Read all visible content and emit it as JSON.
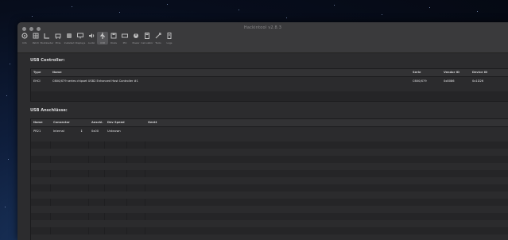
{
  "window": {
    "title": "Hackintool v2.8.3"
  },
  "toolbar": {
    "items": [
      {
        "label": "Info",
        "icon": "gear-icon"
      },
      {
        "label": "Patch",
        "icon": "puzzle-icon"
      },
      {
        "label": "Bootloader",
        "icon": "boot-icon"
      },
      {
        "label": "PCIe",
        "icon": "pcie-icon"
      },
      {
        "label": "Installed",
        "icon": "package-icon"
      },
      {
        "label": "Displays",
        "icon": "display-icon"
      },
      {
        "label": "Audio",
        "icon": "speaker-icon"
      },
      {
        "label": "USB",
        "icon": "usb-icon",
        "active": true
      },
      {
        "label": "Disks",
        "icon": "disk-icon"
      },
      {
        "label": "PCI",
        "icon": "pci-icon"
      },
      {
        "label": "Power",
        "icon": "power-icon"
      },
      {
        "label": "Calculator",
        "icon": "calculator-icon"
      },
      {
        "label": "Tools",
        "icon": "tools-icon"
      },
      {
        "label": "Logs",
        "icon": "log-icon"
      }
    ]
  },
  "usb_controller": {
    "title": "USB Controller:",
    "columns": [
      "Type",
      "Name",
      "Serie",
      "Vendor ID",
      "Device ID"
    ],
    "rows": [
      [
        "EHCI",
        "C600/X79 series chipset USB2 Enhanced Host Controller #1",
        "C600/X79",
        "0x8086",
        "0x1D26"
      ]
    ]
  },
  "usb_ports": {
    "title": "USB Anschlüsse:",
    "columns": [
      "Name",
      "Connector",
      "Anschl.",
      "Dev Speed",
      "Gerät"
    ],
    "rows": [
      [
        "PR21",
        "Internal",
        "0x00",
        "Unknown",
        ""
      ]
    ]
  }
}
